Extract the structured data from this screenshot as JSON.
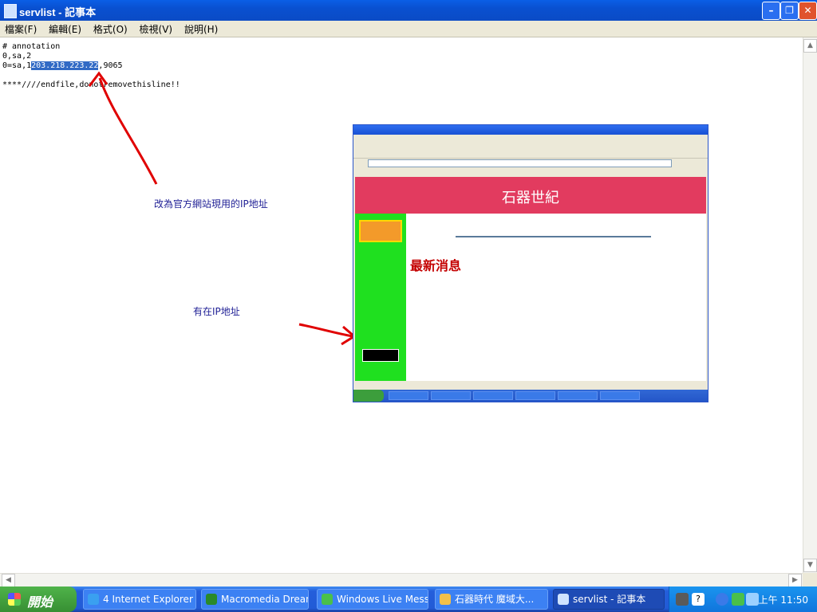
{
  "window": {
    "title": "servlist - 記事本",
    "minimize_icon": "minimize-icon",
    "maximize_icon": "restore-icon",
    "close_icon": "close-icon"
  },
  "menu": [
    "檔案(F)",
    "編輯(E)",
    "格式(O)",
    "檢視(V)",
    "說明(H)"
  ],
  "editor": {
    "line1": "# annotation",
    "line2": "0,sa,2",
    "line3_prefix": "0=sa,1",
    "line3_selected": "203.218.223.22",
    "line3_suffix": ",9065",
    "line5": "****////endfile,donotremovethisline!!"
  },
  "annotations": {
    "note1": "改為官方網站現用的IP地址",
    "note2": "有在IP地址",
    "arrow_color": "#e00000"
  },
  "screenshot": {
    "banner_title": "石器世紀",
    "news_heading": "最新消息",
    "banner_color": "#e23b5f",
    "sidebar_color": "#1fe01f"
  },
  "taskbar": {
    "start_label": "開始",
    "items": [
      {
        "label": "4 Internet Explorer",
        "icon": "ie-icon",
        "color": "#3aa0f0"
      },
      {
        "label": "Macromedia Dream...",
        "icon": "dreamweaver-icon",
        "color": "#2a8a2a"
      },
      {
        "label": "Windows Live Mess...",
        "icon": "messenger-icon",
        "color": "#4ac04a"
      },
      {
        "label": "石器時代 魔域大...",
        "icon": "folder-icon",
        "color": "#f2c04a"
      },
      {
        "label": "servlist - 記事本",
        "icon": "notepad-icon",
        "color": "#cfe3ff"
      }
    ],
    "clock": "上午 11:50"
  }
}
